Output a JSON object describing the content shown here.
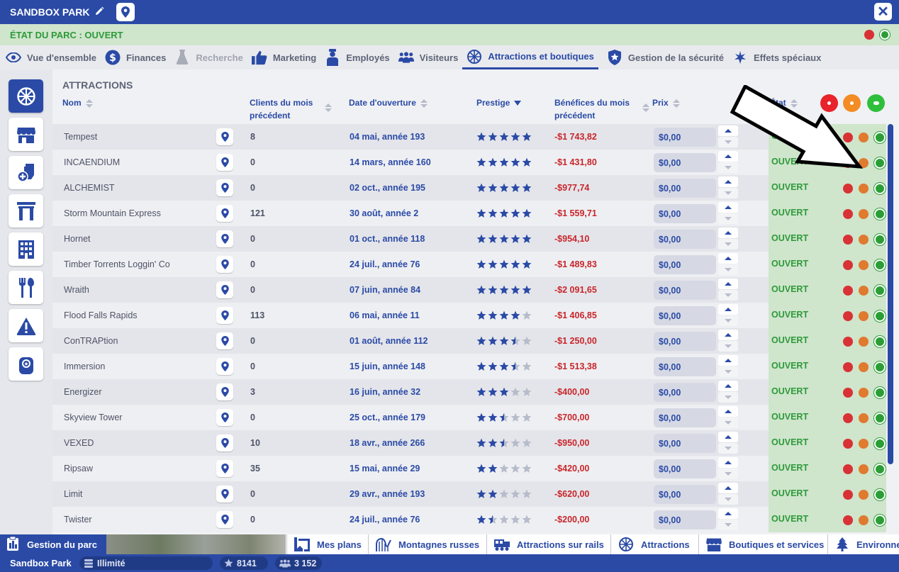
{
  "window": {
    "title": "SANDBOX PARK",
    "close_label": "✕"
  },
  "park_status": {
    "text": "ÉTAT DU PARC : OUVERT"
  },
  "tabs": [
    {
      "label": "Vue d'ensemble",
      "icon": "eye-icon",
      "state": "normal"
    },
    {
      "label": "Finances",
      "icon": "dollar-icon",
      "state": "normal"
    },
    {
      "label": "Recherche",
      "icon": "flask-icon",
      "state": "disabled"
    },
    {
      "label": "Marketing",
      "icon": "thumbs-up-icon",
      "state": "normal"
    },
    {
      "label": "Employés",
      "icon": "staff-icon",
      "state": "normal"
    },
    {
      "label": "Visiteurs",
      "icon": "visitors-icon",
      "state": "normal"
    },
    {
      "label": "Attractions et boutiques",
      "icon": "ferris-wheel-icon",
      "state": "active"
    },
    {
      "label": "Gestion de la sécurité",
      "icon": "shield-icon",
      "state": "normal"
    },
    {
      "label": "Effets spéciaux",
      "icon": "sparkle-icon",
      "state": "normal"
    }
  ],
  "sidebar": [
    {
      "icon": "ferris-wheel-icon",
      "active": true
    },
    {
      "icon": "shop-icon",
      "active": false
    },
    {
      "icon": "toilet-icon",
      "active": false
    },
    {
      "icon": "gate-icon",
      "active": false
    },
    {
      "icon": "building-icon",
      "active": false
    },
    {
      "icon": "fork-spoon-icon",
      "active": false
    },
    {
      "icon": "warning-icon",
      "active": false
    },
    {
      "icon": "coin-icon",
      "active": false
    }
  ],
  "section_title": "ATTRACTIONS",
  "columns": {
    "name": "Nom",
    "clients": "Clients du mois précédent",
    "date": "Date d'ouverture",
    "prestige": "Prestige",
    "benefits": "Bénéfices du mois précédent",
    "price": "Prix",
    "state": "État"
  },
  "colors": {
    "primary": "#2a4aa6",
    "open_green": "#2e9a3a",
    "negative_red": "#c8262b",
    "filter_red": "#e8232b",
    "filter_orange": "#f38c24",
    "filter_green": "#2fbf3c"
  },
  "rows": [
    {
      "name": "Tempest",
      "clients": "8",
      "date": "04 mai, année 193",
      "stars": 5,
      "benefit": "-$1 743,82",
      "price": "$0,00",
      "state": "OUVERT"
    },
    {
      "name": "INCAENDIUM",
      "clients": "0",
      "date": "14 mars, année 160",
      "stars": 5,
      "benefit": "-$1 431,80",
      "price": "$0,00",
      "state": "OUVERT"
    },
    {
      "name": "ALCHEMIST",
      "clients": "0",
      "date": "02 oct., année 195",
      "stars": 5,
      "benefit": "-$977,74",
      "price": "$0,00",
      "state": "OUVERT"
    },
    {
      "name": "Storm Mountain Express",
      "clients": "121",
      "date": "30 août, année 2",
      "stars": 5,
      "benefit": "-$1 559,71",
      "price": "$0,00",
      "state": "OUVERT"
    },
    {
      "name": "Hornet",
      "clients": "0",
      "date": "01 oct., année 118",
      "stars": 5,
      "benefit": "-$954,10",
      "price": "$0,00",
      "state": "OUVERT"
    },
    {
      "name": "Timber Torrents Loggin' Co",
      "clients": "0",
      "date": "24 juil., année 76",
      "stars": 5,
      "benefit": "-$1 489,83",
      "price": "$0,00",
      "state": "OUVERT"
    },
    {
      "name": "Wraith",
      "clients": "0",
      "date": "07 juin, année 84",
      "stars": 5,
      "benefit": "-$2 091,65",
      "price": "$0,00",
      "state": "OUVERT"
    },
    {
      "name": "Flood Falls Rapids",
      "clients": "113",
      "date": "06 mai, année 11",
      "stars": 4,
      "benefit": "-$1 406,85",
      "price": "$0,00",
      "state": "OUVERT"
    },
    {
      "name": "ConTRAPtion",
      "clients": "0",
      "date": "01 août, année 112",
      "stars": 3.5,
      "benefit": "-$1 250,00",
      "price": "$0,00",
      "state": "OUVERT"
    },
    {
      "name": "Immersion",
      "clients": "0",
      "date": "15 juin, année 148",
      "stars": 3.5,
      "benefit": "-$1 513,38",
      "price": "$0,00",
      "state": "OUVERT"
    },
    {
      "name": "Energizer",
      "clients": "3",
      "date": "16 juin, année 32",
      "stars": 3,
      "benefit": "-$400,00",
      "price": "$0,00",
      "state": "OUVERT"
    },
    {
      "name": "Skyview Tower",
      "clients": "0",
      "date": "25 oct., année 179",
      "stars": 2.5,
      "benefit": "-$700,00",
      "price": "$0,00",
      "state": "OUVERT"
    },
    {
      "name": "VEXED",
      "clients": "10",
      "date": "18 avr., année 266",
      "stars": 2.5,
      "benefit": "-$950,00",
      "price": "$0,00",
      "state": "OUVERT"
    },
    {
      "name": "Ripsaw",
      "clients": "35",
      "date": "15 mai, année 29",
      "stars": 2,
      "benefit": "-$420,00",
      "price": "$0,00",
      "state": "OUVERT"
    },
    {
      "name": "Limit",
      "clients": "0",
      "date": "29 avr., année 193",
      "stars": 2,
      "benefit": "-$620,00",
      "price": "$0,00",
      "state": "OUVERT"
    },
    {
      "name": "Twister",
      "clients": "0",
      "date": "24 juil., année 76",
      "stars": 1.5,
      "benefit": "-$200,00",
      "price": "$0,00",
      "state": "OUVERT"
    }
  ],
  "bottom_nav": {
    "park_management": "Gestion du parc",
    "tabs": [
      {
        "label": "Mes plans",
        "icon": "blueprint-icon"
      },
      {
        "label": "Montagnes russes",
        "icon": "coaster-icon"
      },
      {
        "label": "Attractions sur rails",
        "icon": "train-icon"
      },
      {
        "label": "Attractions",
        "icon": "ferris-wheel-icon"
      },
      {
        "label": "Boutiques et services",
        "icon": "shop-icon"
      },
      {
        "label": "Environne",
        "icon": "tree-icon"
      }
    ]
  },
  "footer": {
    "park_name": "Sandbox Park",
    "money": "Illimité",
    "rating": "8141",
    "guests": "3 152"
  }
}
